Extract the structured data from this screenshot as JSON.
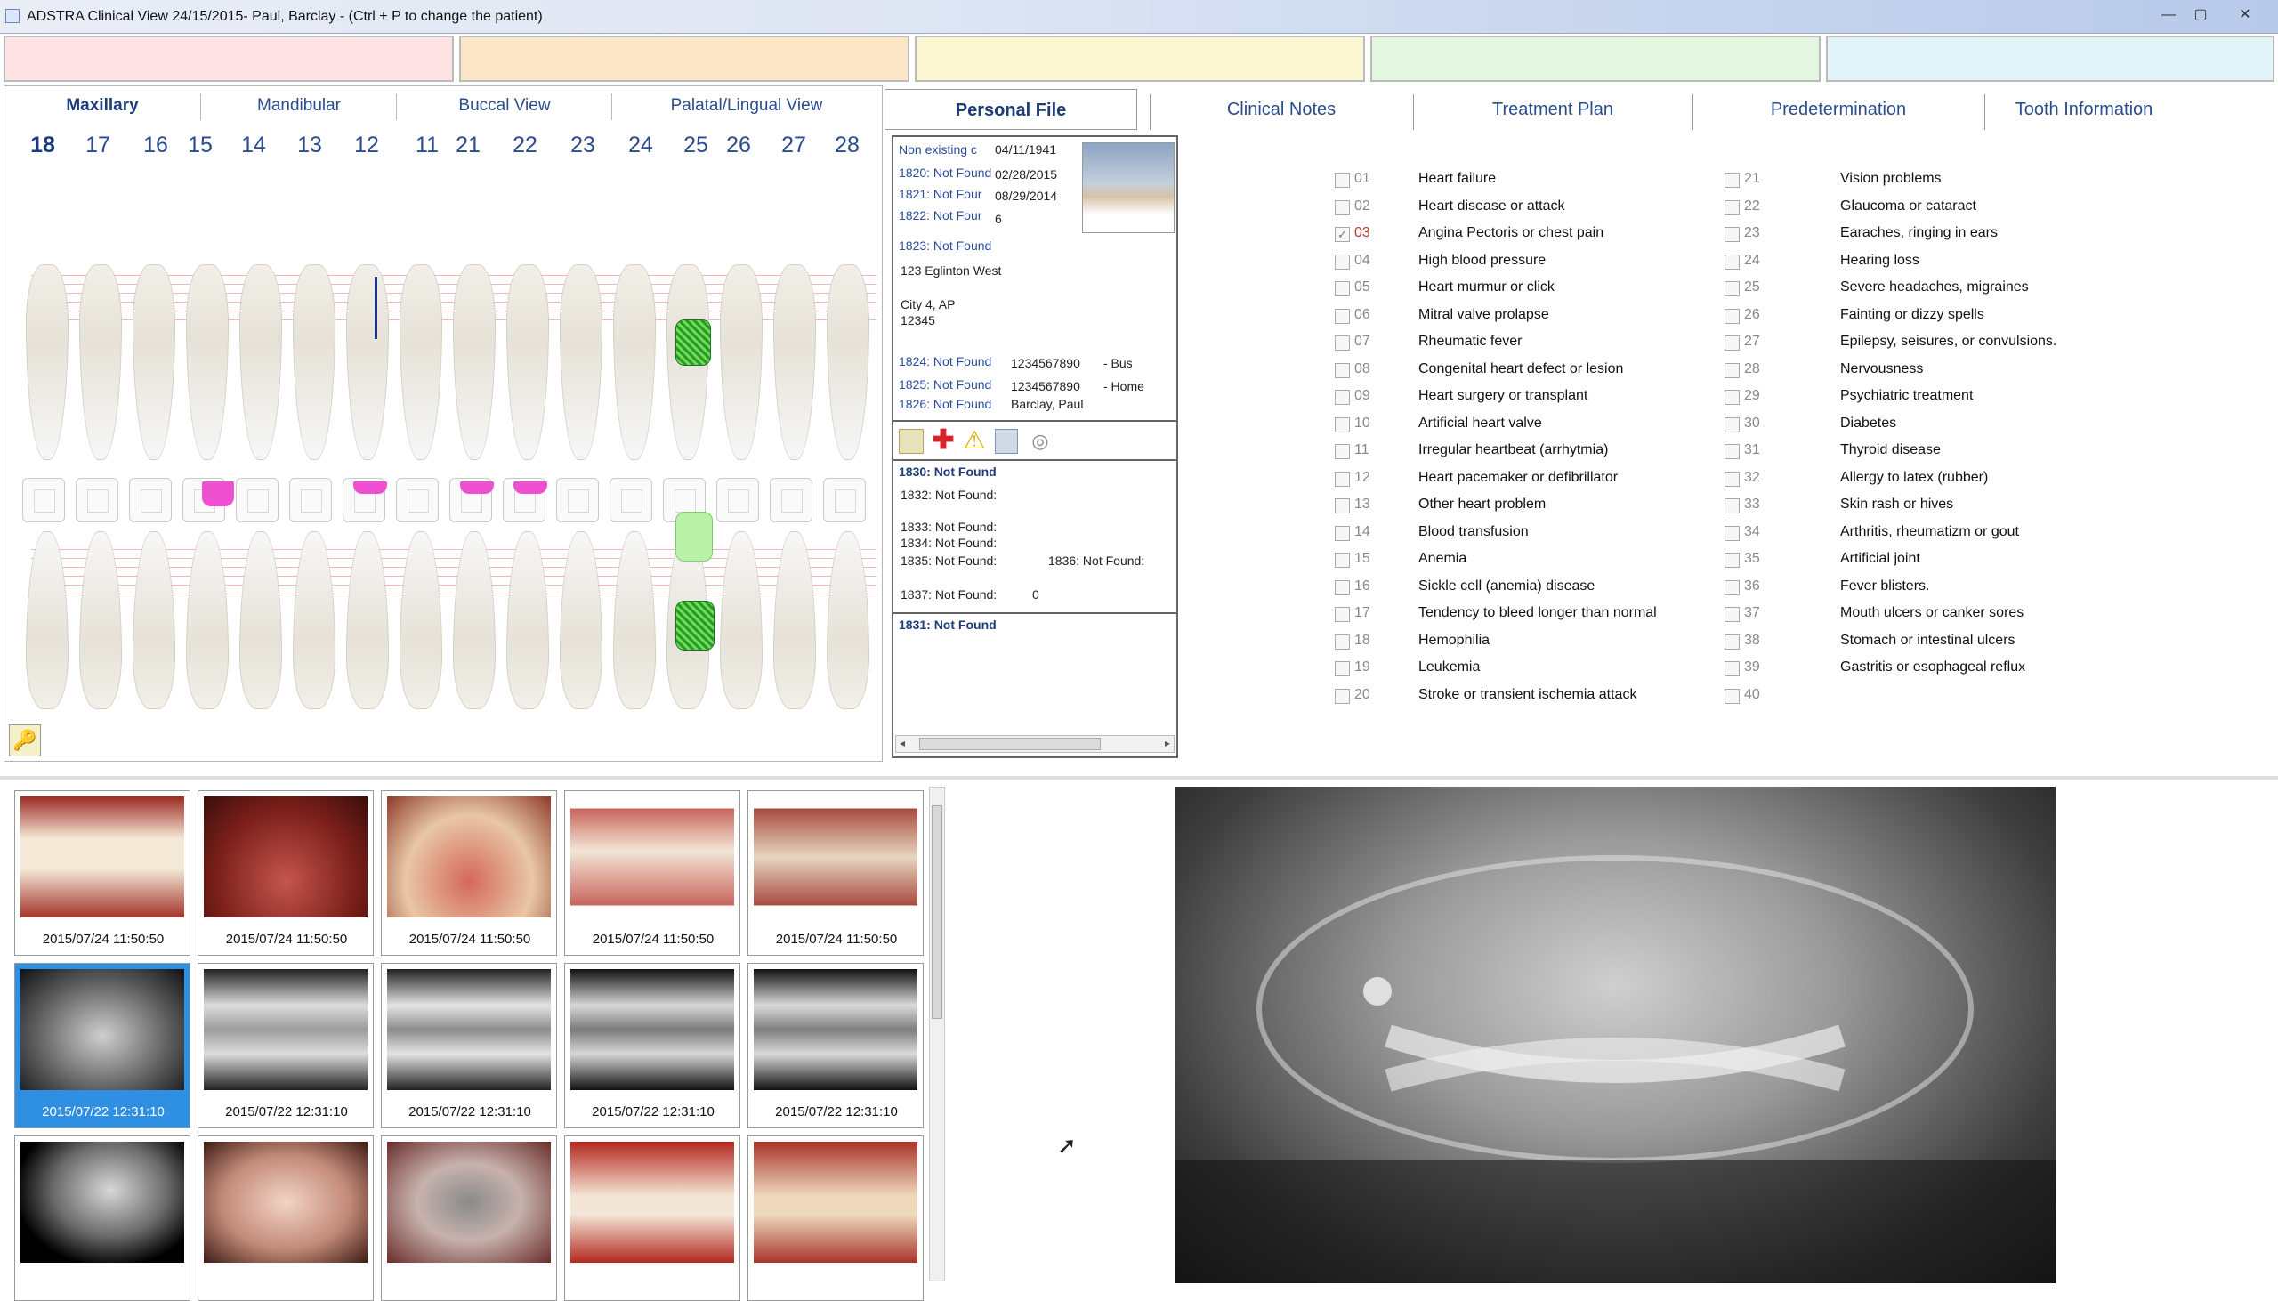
{
  "window": {
    "title": "ADSTRA Clinical View 24/15/2015- Paul, Barclay - (Ctrl + P to change the patient)",
    "controls": [
      "—",
      "▢",
      "✕"
    ]
  },
  "color_strip": [
    "#fde3e3",
    "#fbe6c8",
    "#fbf7d2",
    "#e3f6df",
    "#e2f4f8"
  ],
  "chart": {
    "view_tabs": [
      "Maxillary",
      "Mandibular",
      "Buccal View",
      "Palatal/Lingual View"
    ],
    "active_tab": "Maxillary",
    "tooth_numbers": [
      "18",
      "17",
      "16",
      "15",
      "14",
      "13",
      "12",
      "11",
      "21",
      "22",
      "23",
      "24",
      "25",
      "26",
      "27",
      "28"
    ],
    "active_tooth": "18"
  },
  "right_tabs": {
    "tabs": [
      "Personal File",
      "Clinical Notes",
      "Treatment Plan",
      "Predetermination",
      "Tooth Information"
    ],
    "active": "Personal File"
  },
  "personal_file": {
    "rows": [
      {
        "label": "Non existing c",
        "value": "04/11/1941"
      },
      {
        "label": "1820: Not Found",
        "value": "02/28/2015"
      },
      {
        "label": "1821: Not Four",
        "value": "08/29/2014"
      },
      {
        "label": "1822: Not Four",
        "value": "6"
      }
    ],
    "r1823": "1823: Not Found",
    "address1": "123 Eglinton West",
    "address2": "City 4, AP",
    "address3": "12345",
    "phones": [
      {
        "label": "1824: Not Found",
        "number": "1234567890",
        "type": "- Bus"
      },
      {
        "label": "1825: Not Found",
        "number": "1234567890",
        "type": "- Home"
      }
    ],
    "r1826_label": "1826: Not Found",
    "r1826_value": "Barclay, Paul",
    "section2": {
      "r1830": "1830: Not Found",
      "r1832": "1832: Not Found:",
      "r1833": "1833: Not Found:",
      "r1834": "1834: Not Found:",
      "r1835": "1835: Not Found:",
      "r1836": "1836: Not Found:",
      "r1837": "1837: Not Found:",
      "r1837_value": "0"
    },
    "r1831": "1831: Not Found"
  },
  "medical": {
    "col1": [
      {
        "num": "01",
        "label": "Heart failure",
        "checked": false
      },
      {
        "num": "02",
        "label": "Heart disease or attack",
        "checked": false
      },
      {
        "num": "03",
        "label": "Angina Pectoris or chest pain",
        "checked": true
      },
      {
        "num": "04",
        "label": "High blood pressure",
        "checked": false
      },
      {
        "num": "05",
        "label": "Heart murmur or click",
        "checked": false
      },
      {
        "num": "06",
        "label": "Mitral valve prolapse",
        "checked": false
      },
      {
        "num": "07",
        "label": "Rheumatic fever",
        "checked": false
      },
      {
        "num": "08",
        "label": "Congenital heart defect or lesion",
        "checked": false
      },
      {
        "num": "09",
        "label": "Heart surgery or transplant",
        "checked": false
      },
      {
        "num": "10",
        "label": "Artificial heart valve",
        "checked": false
      },
      {
        "num": "11",
        "label": "Irregular heartbeat (arrhytmia)",
        "checked": false
      },
      {
        "num": "12",
        "label": "Heart pacemaker or defibrillator",
        "checked": false
      },
      {
        "num": "13",
        "label": "Other heart problem",
        "checked": false
      },
      {
        "num": "14",
        "label": "Blood transfusion",
        "checked": false
      },
      {
        "num": "15",
        "label": "Anemia",
        "checked": false
      },
      {
        "num": "16",
        "label": "Sickle cell (anemia) disease",
        "checked": false
      },
      {
        "num": "17",
        "label": "Tendency to bleed longer than normal",
        "checked": false
      },
      {
        "num": "18",
        "label": "Hemophilia",
        "checked": false
      },
      {
        "num": "19",
        "label": "Leukemia",
        "checked": false
      },
      {
        "num": "20",
        "label": "Stroke or transient ischemia attack",
        "checked": false
      }
    ],
    "col2": [
      {
        "num": "21",
        "label": "Vision problems",
        "checked": false
      },
      {
        "num": "22",
        "label": "Glaucoma or cataract",
        "checked": false
      },
      {
        "num": "23",
        "label": "Earaches, ringing in ears",
        "checked": false
      },
      {
        "num": "24",
        "label": "Hearing loss",
        "checked": false
      },
      {
        "num": "25",
        "label": "Severe headaches, migraines",
        "checked": false
      },
      {
        "num": "26",
        "label": "Fainting or dizzy spells",
        "checked": false
      },
      {
        "num": "27",
        "label": "Epilepsy, seisures, or convulsions.",
        "checked": false
      },
      {
        "num": "28",
        "label": "Nervousness",
        "checked": false
      },
      {
        "num": "29",
        "label": "Psychiatric treatment",
        "checked": false
      },
      {
        "num": "30",
        "label": "Diabetes",
        "checked": false
      },
      {
        "num": "31",
        "label": "Thyroid disease",
        "checked": false
      },
      {
        "num": "32",
        "label": "Allergy to latex (rubber)",
        "checked": false
      },
      {
        "num": "33",
        "label": "Skin rash or hives",
        "checked": false
      },
      {
        "num": "34",
        "label": "Arthritis, rheumatizm or gout",
        "checked": false
      },
      {
        "num": "35",
        "label": "Artificial joint",
        "checked": false
      },
      {
        "num": "36",
        "label": "Fever blisters.",
        "checked": false
      },
      {
        "num": "37",
        "label": "Mouth ulcers or canker sores",
        "checked": false
      },
      {
        "num": "38",
        "label": "Stomach or intestinal ulcers",
        "checked": false
      },
      {
        "num": "39",
        "label": "Gastritis or esophageal reflux",
        "checked": false
      },
      {
        "num": "40",
        "label": "",
        "checked": false
      }
    ]
  },
  "thumbnails": {
    "row1": [
      "2015/07/24 11:50:50",
      "2015/07/24 11:50:50",
      "2015/07/24 11:50:50",
      "2015/07/24 11:50:50",
      "2015/07/24 11:50:50"
    ],
    "row2": [
      "2015/07/22 12:31:10",
      "2015/07/22 12:31:10",
      "2015/07/22 12:31:10",
      "2015/07/22 12:31:10",
      "2015/07/22 12:31:10"
    ]
  }
}
